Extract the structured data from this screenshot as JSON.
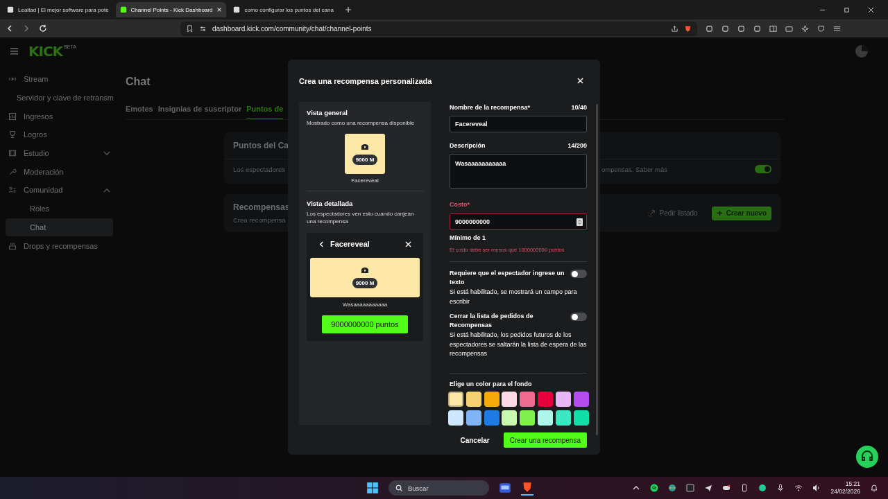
{
  "browser": {
    "tabs": [
      {
        "title": "Lealtad | El mejor software para pote",
        "selected": false
      },
      {
        "title": "Channel Points - Kick Dashboard",
        "selected": true
      },
      {
        "title": "como configurar los puntos del cana",
        "selected": false
      }
    ],
    "url": "dashboard.kick.com/community/chat/channel-points"
  },
  "header": {
    "logo": "KICK",
    "logo_tag": "BETA"
  },
  "sidebar": {
    "items": [
      {
        "label": "Stream",
        "children": [
          {
            "label": "Servidor y clave de retransm",
            "selected": false
          }
        ]
      },
      {
        "label": "Ingresos"
      },
      {
        "label": "Logros"
      },
      {
        "label": "Estudio",
        "expanded": false
      },
      {
        "label": "Moderación"
      },
      {
        "label": "Comunidad",
        "expanded": true,
        "children": [
          {
            "label": "Roles",
            "selected": false
          },
          {
            "label": "Chat",
            "selected": true
          }
        ]
      },
      {
        "label": "Drops y recompensas"
      }
    ]
  },
  "main": {
    "title": "Chat",
    "tabs": [
      {
        "label": "Emotes",
        "selected": false
      },
      {
        "label": "Insignias de suscriptor",
        "selected": false
      },
      {
        "label": "Puntos de",
        "selected": true
      }
    ],
    "points_card": {
      "title": "Puntos del Ca",
      "text_left": "Los espectadores",
      "text_right": "ompensas. Saber más",
      "toggle_on": true
    },
    "rewards_card": {
      "title": "Recompensas",
      "subtitle": "Crea recompensa",
      "link": "Pedir listado",
      "button": "Crear nuevo"
    }
  },
  "modal": {
    "title": "Crea una recompensa personalizada",
    "preview": {
      "overview_title": "Vista general",
      "overview_text": "Mostrado como una recompensa disponible",
      "card_cost": "9000 M",
      "card_name": "Facereveal",
      "detail_title": "Vista detallada",
      "detail_text": "Los espectadores ven esto cuando canjean una recompensa",
      "detail_name": "Facereveal",
      "detail_cost": "9000 M",
      "detail_description": "Wasaaaaaaaaaaa",
      "detail_button": "9000000000 puntos"
    },
    "form": {
      "name_label": "Nombre de la recompensa*",
      "name_count": "10/40",
      "name_value": "Facereveal",
      "desc_label": "Descripción",
      "desc_count": "14/200",
      "desc_value": "Wasaaaaaaaaaaa",
      "cost_label": "Costo*",
      "cost_value": "9000000000",
      "cost_invalid": true,
      "cost_min": "Mínimo de 1",
      "cost_error": "El costo debe ser menos que 1000000000 puntos",
      "toggles": [
        {
          "title": "Requiere que el espectador ingrese un texto",
          "hint": "Si está habilitado, se mostrará un campo para escribir",
          "on": false
        },
        {
          "title": "Cerrar la lista de pedidos de Recompensas",
          "hint": "Si está habilitado, los pedidos futuros de los espectadores se saltarán la lista de espera de las recompensas",
          "on": false
        }
      ],
      "color_label": "Elige un color para el fondo",
      "colors": [
        {
          "color": "#fde8a8",
          "selected": true
        },
        {
          "color": "#f5d06e",
          "selected": false
        },
        {
          "color": "#f5a90b",
          "selected": false
        },
        {
          "color": "#fdd9e5",
          "selected": false
        },
        {
          "color": "#ef6b8f",
          "selected": false
        },
        {
          "color": "#e4003a",
          "selected": false
        },
        {
          "color": "#e8b6f5",
          "selected": false
        },
        {
          "color": "#b54cf0",
          "selected": false
        },
        {
          "color": "#cfe6ff",
          "selected": false
        },
        {
          "color": "#7fb4f7",
          "selected": false
        },
        {
          "color": "#1e7be5",
          "selected": false
        },
        {
          "color": "#c8f7b0",
          "selected": false
        },
        {
          "color": "#7ff04d",
          "selected": false
        },
        {
          "color": "#aef5ec",
          "selected": false
        },
        {
          "color": "#3ce8c4",
          "selected": false
        },
        {
          "color": "#10e0a8",
          "selected": false
        }
      ],
      "cancel": "Cancelar",
      "submit": "Crear una recompensa"
    }
  },
  "taskbar": {
    "search_placeholder": "Buscar",
    "time": "15:21",
    "date": "24/02/2026"
  }
}
